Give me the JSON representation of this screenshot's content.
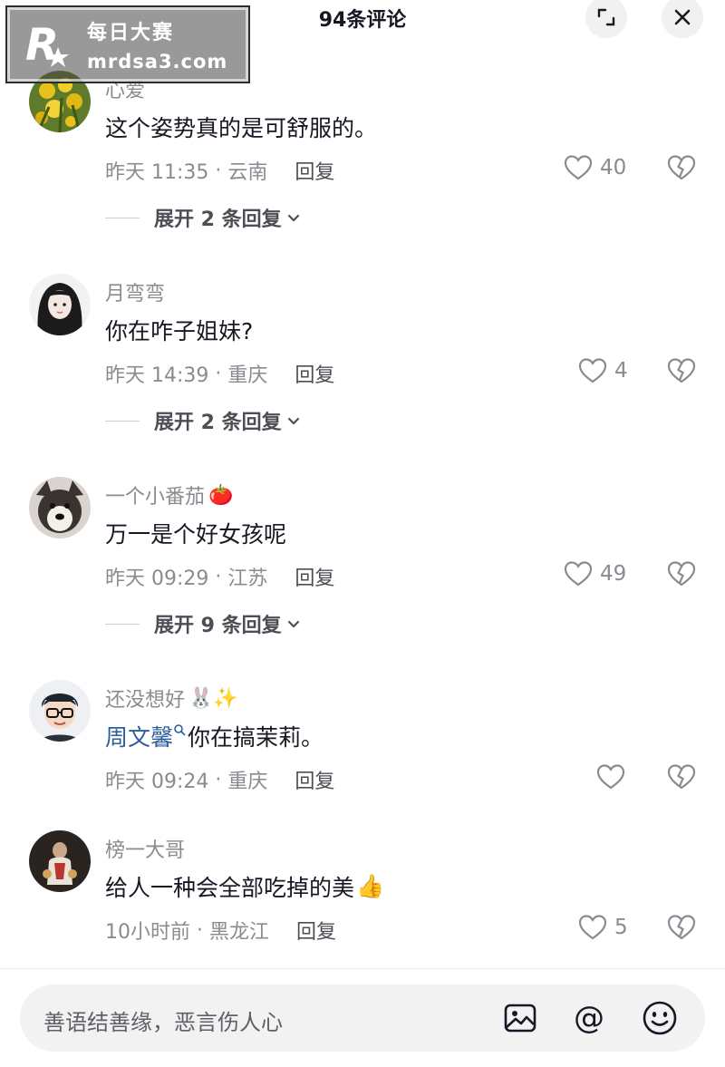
{
  "watermark": {
    "line1": "每日大赛",
    "line2": "mrdsa3.com"
  },
  "header": {
    "title": "94条评论",
    "expand_icon": "expand-icon",
    "close_icon": "close-icon"
  },
  "comments": [
    {
      "username": "心爱",
      "text": "这个姿势真的是可舒服的。",
      "time": "昨天 11:35",
      "location": "云南",
      "reply_label": "回复",
      "likes": "40",
      "expand_label": "展开 2 条回复",
      "avatar": "yellow-flowers"
    },
    {
      "username": "月弯弯",
      "text": "你在咋子姐妹?",
      "time": "昨天 14:39",
      "location": "重庆",
      "reply_label": "回复",
      "likes": "4",
      "expand_label": "展开 2 条回复",
      "avatar": "anime-girl"
    },
    {
      "username": "一个小番茄",
      "username_emoji": "🍅",
      "text": "万一是个好女孩呢",
      "time": "昨天 09:29",
      "location": "江苏",
      "reply_label": "回复",
      "likes": "49",
      "expand_label": "展开 9 条回复",
      "avatar": "dog"
    },
    {
      "username": "还没想好",
      "username_emoji": "🐰✨",
      "mention": "周文馨",
      "text": "你在搞茉莉。",
      "time": "昨天 09:24",
      "location": "重庆",
      "reply_label": "回复",
      "likes": "",
      "avatar": "cartoon-boy"
    },
    {
      "username": "榜一大哥",
      "text": "给人一种会全部吃掉的美",
      "text_emoji": "👍",
      "time": "10小时前",
      "location": "黑龙江",
      "reply_label": "回复",
      "likes": "5",
      "avatar": "figure-dark"
    }
  ],
  "bottom_bar": {
    "placeholder": "善语结善缘，恶言伤人心",
    "icons": [
      "image-icon",
      "at-icon",
      "emoji-icon"
    ]
  },
  "colors": {
    "text_primary": "#161823",
    "text_secondary": "#8a8b91",
    "mention": "#2c5d9c",
    "input_bg": "#f2f2f3"
  }
}
